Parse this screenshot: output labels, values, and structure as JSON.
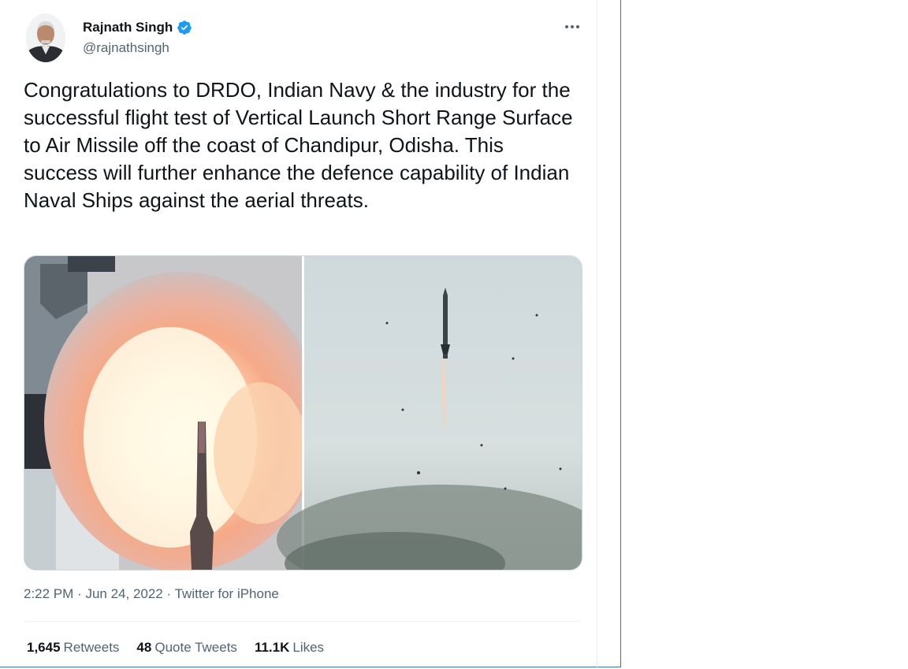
{
  "author": {
    "name": "Rajnath Singh",
    "handle": "@rajnathsingh",
    "verified": true,
    "avatar_icon": "profile-photo"
  },
  "more_icon": "ellipsis-icon",
  "tweet": {
    "text": "Congratulations to DRDO, Indian Navy & the industry for the successful flight test of Vertical Launch Short Range Surface to Air Missile off the coast of Chandipur, Odisha. This success will further enhance the defence capability of Indian Naval Ships against the aerial threats."
  },
  "media": [
    {
      "description_icon": "missile-launch-photo"
    },
    {
      "description_icon": "missile-in-flight-photo"
    }
  ],
  "meta": {
    "time": "2:22 PM",
    "separator": "·",
    "date": "Jun 24, 2022",
    "source": "Twitter for iPhone"
  },
  "stats": [
    {
      "count": "1,645",
      "label": "Retweets"
    },
    {
      "count": "48",
      "label": "Quote Tweets"
    },
    {
      "count": "11.1K",
      "label": "Likes"
    }
  ],
  "colors": {
    "verified_blue": "#1d9bf0",
    "secondary_text": "#536471",
    "primary_text": "#0f1419"
  }
}
